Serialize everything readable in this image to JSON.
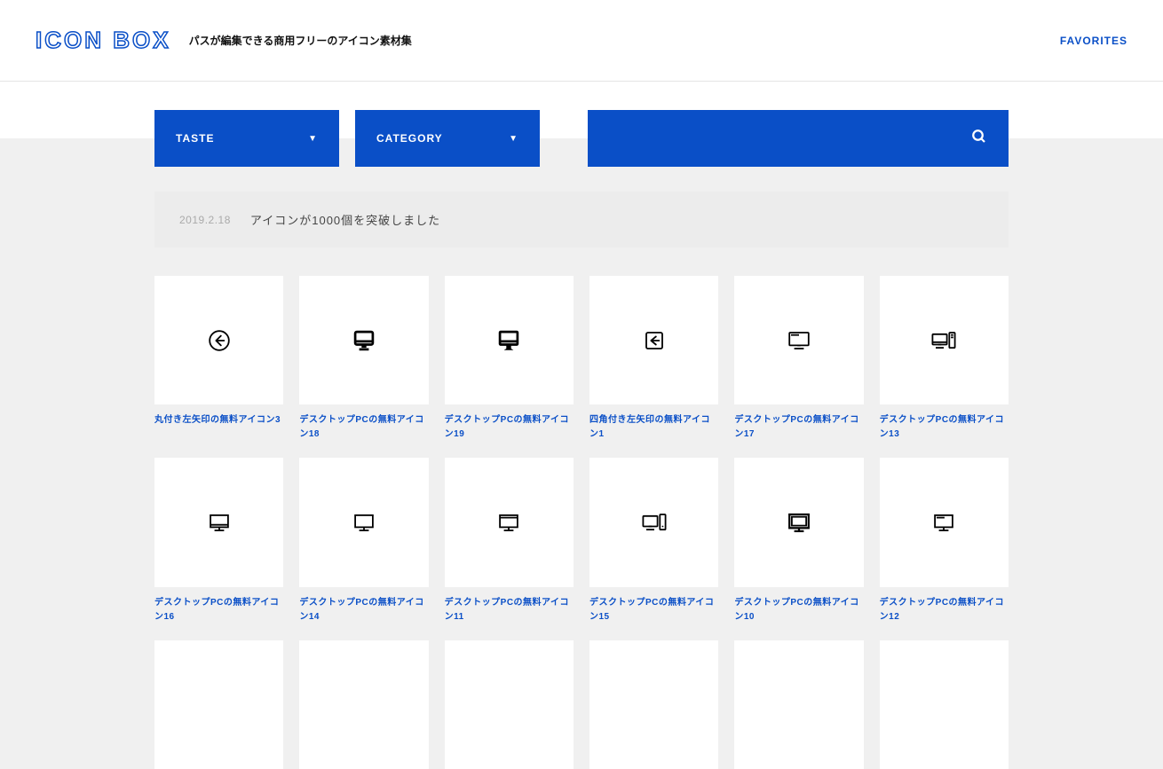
{
  "header": {
    "logo": "ICON BOX",
    "tagline": "パスが編集できる商用フリーのアイコン素材集",
    "favorites": "FAVORITES"
  },
  "filters": {
    "taste": "TASTE",
    "category": "CATEGORY"
  },
  "search": {
    "placeholder": ""
  },
  "news": {
    "date": "2019.2.18",
    "text": "アイコンが1000個を突破しました"
  },
  "icons": [
    {
      "title": "丸付き左矢印の無料アイコン3",
      "type": "circle-left"
    },
    {
      "title": "デスクトップPCの無料アイコン18",
      "type": "imac-thick"
    },
    {
      "title": "デスクトップPCの無料アイコン19",
      "type": "imac-thick2"
    },
    {
      "title": "四角付き左矢印の無料アイコン1",
      "type": "square-left"
    },
    {
      "title": "デスクトップPCの無料アイコン17",
      "type": "monitor-diag"
    },
    {
      "title": "デスクトップPCの無料アイコン13",
      "type": "monitor-tower"
    },
    {
      "title": "デスクトップPCの無料アイコン16",
      "type": "monitor-thin"
    },
    {
      "title": "デスクトップPCの無料アイコン14",
      "type": "monitor-thin2"
    },
    {
      "title": "デスクトップPCの無料アイコン11",
      "type": "monitor-line"
    },
    {
      "title": "デスクトップPCの無料アイコン15",
      "type": "monitor-tower2"
    },
    {
      "title": "デスクトップPCの無料アイコン10",
      "type": "monitor-bold"
    },
    {
      "title": "デスクトップPCの無料アイコン12",
      "type": "monitor-diag2"
    },
    {
      "title": "",
      "type": "blank"
    },
    {
      "title": "",
      "type": "blank"
    },
    {
      "title": "",
      "type": "blank"
    },
    {
      "title": "",
      "type": "blank"
    },
    {
      "title": "",
      "type": "blank"
    },
    {
      "title": "",
      "type": "blank"
    }
  ]
}
